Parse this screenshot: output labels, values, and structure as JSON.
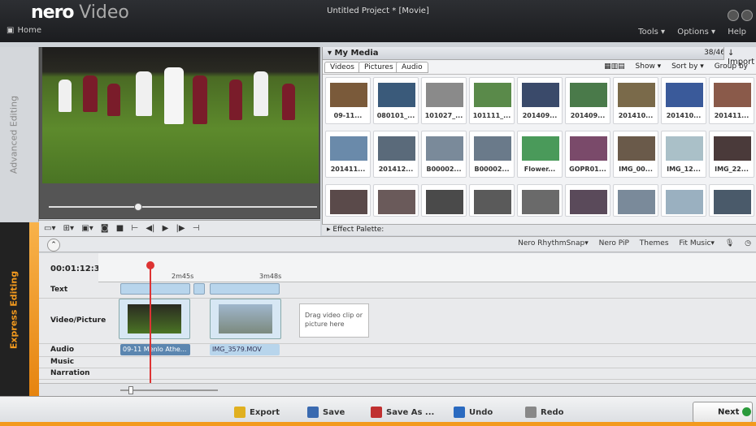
{
  "app": {
    "logo": "nero",
    "product": "Video",
    "window_title": "Untitled Project * [Movie]",
    "home": "Home"
  },
  "menu": [
    "Tools ▾",
    "Options ▾",
    "Help"
  ],
  "side_tabs": {
    "advanced": "Advanced Editing",
    "express": "Express Editing"
  },
  "media": {
    "title": "▾ My Media",
    "count": "38/46",
    "import": "↓ Import",
    "tabs": [
      "Videos",
      "Pictures",
      "Audio"
    ],
    "options": [
      "Show ▾",
      "Sort by ▾",
      "Group by"
    ],
    "items": [
      "09-11...",
      "080101_...",
      "101027_...",
      "101111_...",
      "201409...",
      "201409...",
      "201410...",
      "201410...",
      "201411...",
      "201411...",
      "201412...",
      "B00002...",
      "B00002...",
      "Flower...",
      "GOPR01...",
      "IMG_00...",
      "IMG_12...",
      "IMG_22...",
      "",
      "",
      "",
      "",
      "",
      "",
      "",
      "",
      ""
    ],
    "colors": [
      "#7a5a3a",
      "#3a5a7a",
      "#8a8a8a",
      "#5a8a4a",
      "#3a4a6a",
      "#4a7a4a",
      "#7a6a4a",
      "#3a5a9a",
      "#8a5a4a",
      "#6a8aaa",
      "#5a6a7a",
      "#7a8a9a",
      "#6a7a8a",
      "#4a9a5a",
      "#7a4a6a",
      "#6a5a4a",
      "#aac0c8",
      "#4a3a3a",
      "#5a4a4a",
      "#6a5a5a",
      "#4a4a4a",
      "#5a5a5a",
      "#6a6a6a",
      "#5a4a5a",
      "#7a8a9a",
      "#9ab0c0",
      "#4a5a6a"
    ]
  },
  "effect_palette": "▸ Effect Palette:",
  "fx_tools": [
    "Nero RhythmSnap▾",
    "Nero PiP",
    "Themes",
    "Fit Music▾"
  ],
  "timeline": {
    "timecode": "00:01:12:38",
    "ticks": [
      "2m45s",
      "3m48s"
    ],
    "tracks": [
      "Text",
      "Video/Picture",
      "Audio",
      "Music",
      "Narration"
    ],
    "drop_hint": "Drag video clip or picture here",
    "audio_clips": [
      "09-11 Menlo Athe...",
      "IMG_3579.MOV"
    ]
  },
  "bottom": {
    "export": "Export",
    "save": "Save",
    "save_as": "Save As ...",
    "undo": "Undo",
    "redo": "Redo",
    "next": "Next"
  }
}
